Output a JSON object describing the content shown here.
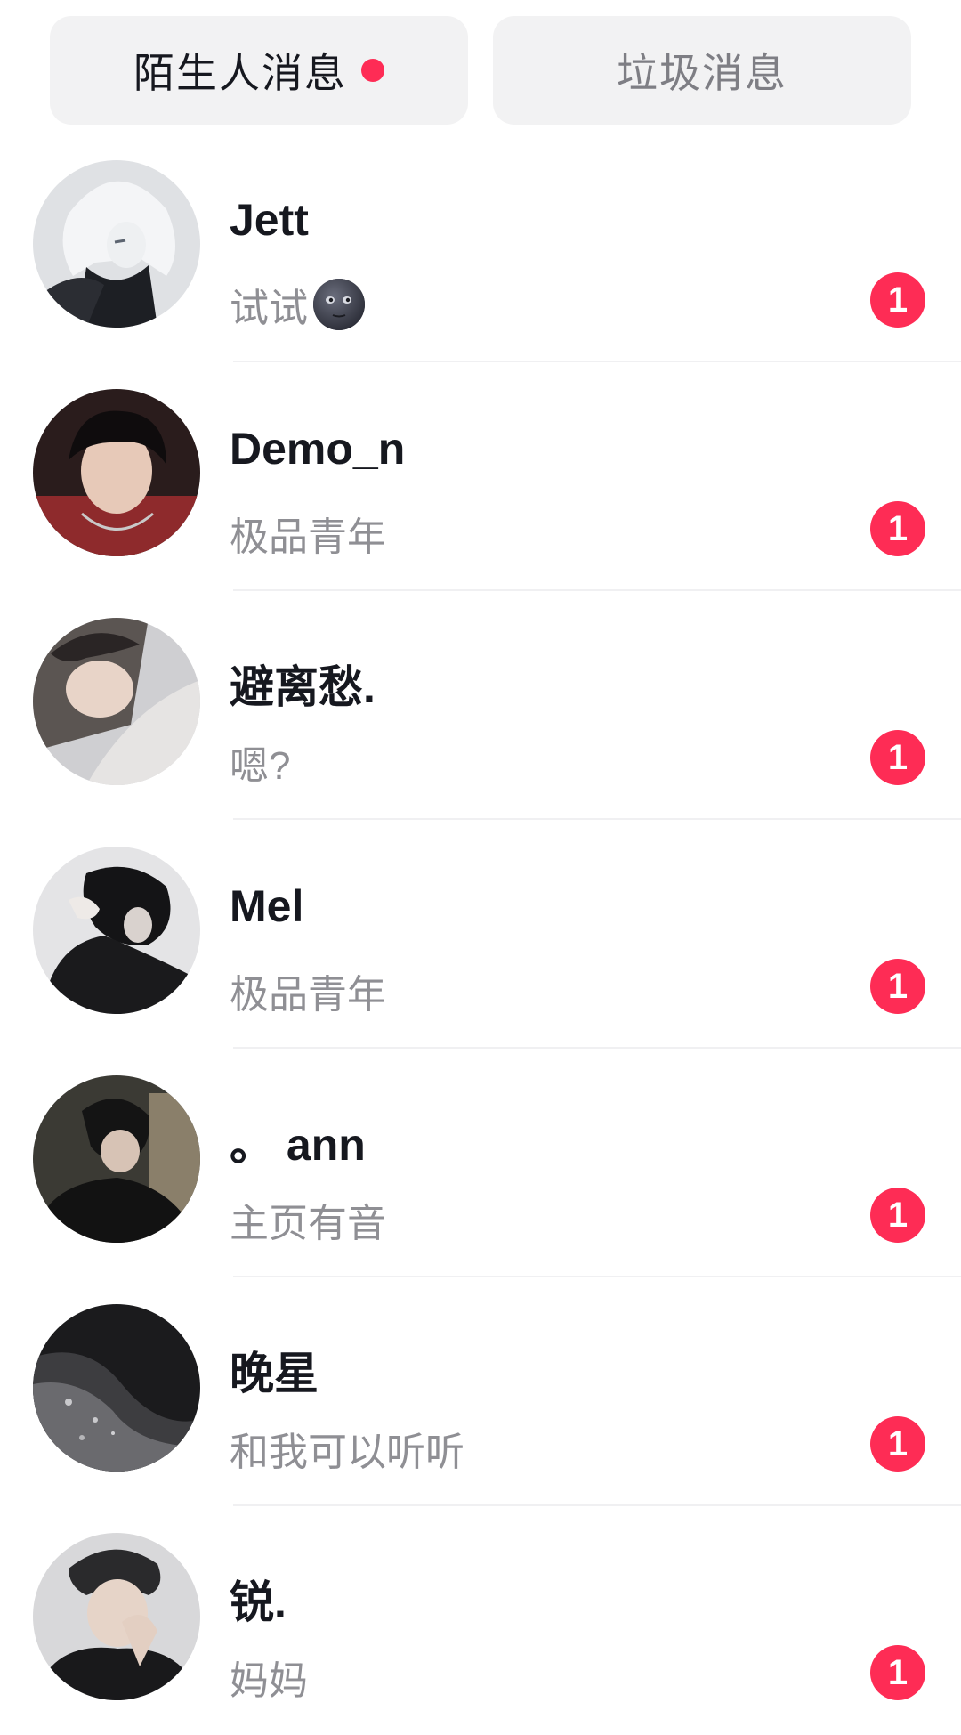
{
  "colors": {
    "accent_red": "#fe2c55",
    "tab_bg": "#f2f2f3"
  },
  "tabs": [
    {
      "label": "陌生人消息",
      "active": true,
      "has_dot": true
    },
    {
      "label": "垃圾消息",
      "active": false,
      "has_dot": false
    }
  ],
  "conversations": [
    {
      "name": "Jett",
      "preview": "试试",
      "preview_emoji": "new-moon-face-emoji",
      "unread": "1",
      "avatar": "anime-avatar-white-hair"
    },
    {
      "name": "Demo_n",
      "preview": "极品青年",
      "unread": "1",
      "avatar": "photo-avatar"
    },
    {
      "name": "避离愁.",
      "preview": "嗯?",
      "unread": "1",
      "avatar": "photo-avatar"
    },
    {
      "name": "Mel",
      "preview": "极品青年",
      "unread": "1",
      "avatar": "photo-avatar"
    },
    {
      "name": "。 ann",
      "preview": "主页有音",
      "unread": "1",
      "avatar": "photo-avatar"
    },
    {
      "name": "晚星",
      "preview": "和我可以听听",
      "unread": "1",
      "avatar": "photo-avatar"
    },
    {
      "name": "锐.",
      "preview": "妈妈",
      "unread": "1",
      "avatar": "photo-avatar"
    }
  ]
}
